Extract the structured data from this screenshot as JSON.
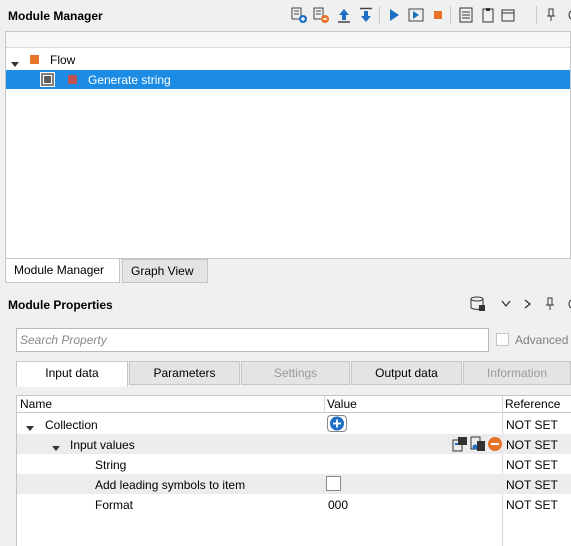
{
  "module_manager": {
    "title": "Module Manager",
    "toolbar_icons": [
      "add-module-icon",
      "remove-module-icon",
      "move-up-icon",
      "move-down-icon",
      "run-icon",
      "run-step-icon",
      "stop-icon",
      "properties-icon",
      "clipboard-icon",
      "window-options-icon",
      "pin-icon",
      "close-icon"
    ],
    "tree": [
      {
        "label": "Flow",
        "color": "#e8732a",
        "expanded": true
      },
      {
        "label": "Generate string",
        "color": "#c0504d",
        "selected": true
      }
    ],
    "tabs": [
      "Module Manager",
      "Graph View"
    ],
    "active_tab": "Module Manager"
  },
  "module_properties": {
    "title": "Module Properties",
    "search_placeholder": "Search Property",
    "advanced_label": "Advanced",
    "tabs": [
      "Input data",
      "Parameters",
      "Settings",
      "Output data",
      "Information"
    ],
    "active_tab": "Input data",
    "disabled_tabs": [
      "Settings",
      "Information"
    ],
    "grid": {
      "columns": [
        "Name",
        "Value",
        "Reference"
      ],
      "rows": [
        {
          "name": "Collection",
          "value": "",
          "reference": "NOT SET",
          "level": 0,
          "expandable": true
        },
        {
          "name": "Input values",
          "value": "",
          "reference": "NOT SET",
          "level": 1,
          "expandable": true
        },
        {
          "name": "String",
          "value": "",
          "reference": "NOT SET",
          "level": 2
        },
        {
          "name": "Add leading symbols to item",
          "value": "",
          "reference": "NOT SET",
          "level": 2,
          "checkbox": true
        },
        {
          "name": "Format",
          "value": "000",
          "reference": "NOT SET",
          "level": 2
        }
      ]
    }
  },
  "colors": {
    "selection": "#1b8be4",
    "accent_blue": "#1e6fc4",
    "stop_orange": "#e8732a"
  }
}
